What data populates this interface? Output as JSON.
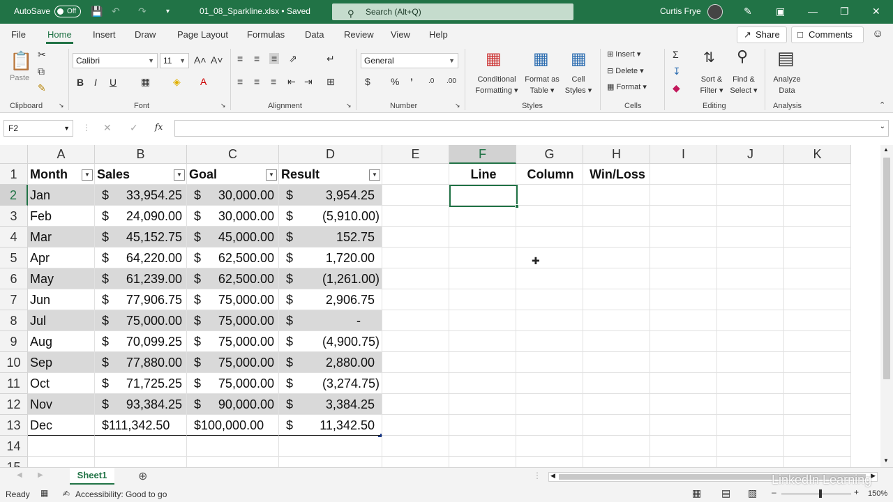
{
  "titlebar": {
    "autosave_label": "AutoSave",
    "autosave_state": "Off",
    "filename": "01_08_Sparkline.xlsx • Saved",
    "search_placeholder": "Search (Alt+Q)",
    "user": "Curtis Frye"
  },
  "menu": {
    "tabs": [
      "File",
      "Home",
      "Insert",
      "Draw",
      "Page Layout",
      "Formulas",
      "Data",
      "Review",
      "View",
      "Help"
    ],
    "active": "Home",
    "share": "Share",
    "comments": "Comments"
  },
  "ribbon": {
    "paste": "Paste",
    "font_name": "Calibri",
    "font_size": "11",
    "number_format": "General",
    "conditional_formatting": [
      "Conditional",
      "Formatting"
    ],
    "format_as_table": [
      "Format as",
      "Table"
    ],
    "cell_styles": [
      "Cell",
      "Styles"
    ],
    "insert": "Insert",
    "delete": "Delete",
    "format": "Format",
    "sort_filter": [
      "Sort &",
      "Filter"
    ],
    "find_select": [
      "Find &",
      "Select"
    ],
    "analyze_data": [
      "Analyze",
      "Data"
    ],
    "groups": [
      "Clipboard",
      "Font",
      "Alignment",
      "Number",
      "Styles",
      "Cells",
      "Editing",
      "Analysis"
    ]
  },
  "formula_bar": {
    "name_box": "F2",
    "fx": "fx",
    "value": ""
  },
  "columns": [
    "A",
    "B",
    "C",
    "D",
    "E",
    "F",
    "G",
    "H",
    "I",
    "J",
    "K"
  ],
  "rows": [
    "1",
    "2",
    "3",
    "4",
    "5",
    "6",
    "7",
    "8",
    "9",
    "10",
    "11",
    "12",
    "13",
    "14",
    "15"
  ],
  "table": {
    "headers": [
      "Month",
      "Sales",
      "Goal",
      "Result"
    ],
    "rows": [
      [
        "Jan",
        "33,954.25",
        "30,000.00",
        "3,954.25"
      ],
      [
        "Feb",
        "24,090.00",
        "30,000.00",
        "(5,910.00)"
      ],
      [
        "Mar",
        "45,152.75",
        "45,000.00",
        "152.75"
      ],
      [
        "Apr",
        "64,220.00",
        "62,500.00",
        "1,720.00"
      ],
      [
        "May",
        "61,239.00",
        "62,500.00",
        "(1,261.00)"
      ],
      [
        "Jun",
        "77,906.75",
        "75,000.00",
        "2,906.75"
      ],
      [
        "Jul",
        "75,000.00",
        "75,000.00",
        "-"
      ],
      [
        "Aug",
        "70,099.25",
        "75,000.00",
        "(4,900.75)"
      ],
      [
        "Sep",
        "77,880.00",
        "75,000.00",
        "2,880.00"
      ],
      [
        "Oct",
        "71,725.25",
        "75,000.00",
        "(3,274.75)"
      ],
      [
        "Nov",
        "93,384.25",
        "90,000.00",
        "3,384.25"
      ],
      [
        "Dec",
        "$111,342.50",
        "$100,000.00",
        "11,342.50"
      ]
    ],
    "currency": "$"
  },
  "sparkline_headers": [
    "Line",
    "Column",
    "Win/Loss"
  ],
  "sheet_tab": "Sheet1",
  "status": {
    "ready": "Ready",
    "accessibility": "Accessibility: Good to go",
    "zoom": "150%"
  },
  "watermark": "LinkedIn Learning",
  "colors": {
    "accent": "#217346",
    "band": "#d9d9d9"
  }
}
